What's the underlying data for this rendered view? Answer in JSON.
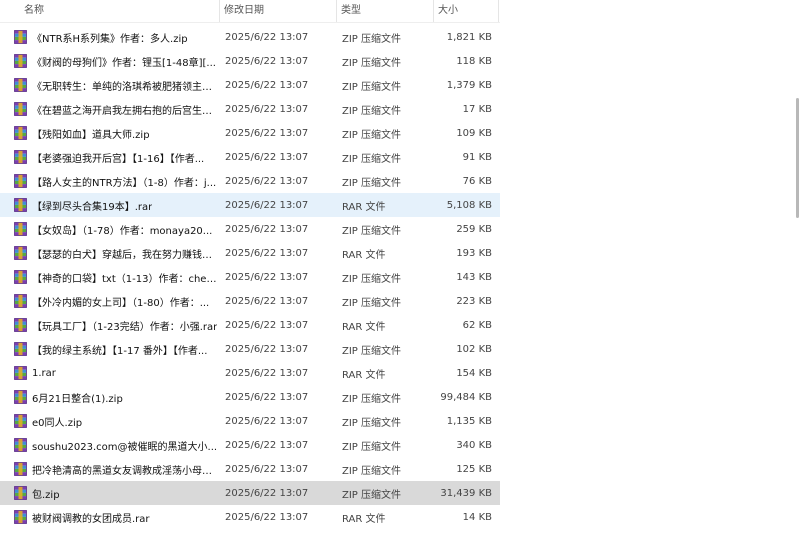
{
  "columns": {
    "name": "名称",
    "date": "修改日期",
    "type": "类型",
    "size": "大小"
  },
  "sort_indicator": "^",
  "files": [
    {
      "name": "《NTR系H系列集》作者：多人.zip",
      "date": "2025/6/22 13:07",
      "type": "ZIP 压缩文件",
      "size": "1,821 KB",
      "state": "normal"
    },
    {
      "name": "《财阀的母狗们》作者：锂玉[1-48章][...",
      "date": "2025/6/22 13:07",
      "type": "ZIP 压缩文件",
      "size": "118 KB",
      "state": "normal"
    },
    {
      "name": "《无职转生：单纯的洛琪希被肥猪领主邀...",
      "date": "2025/6/22 13:07",
      "type": "ZIP 压缩文件",
      "size": "1,379 KB",
      "state": "normal"
    },
    {
      "name": "《在碧蓝之海开启我左拥右抱的后宫生活...",
      "date": "2025/6/22 13:07",
      "type": "ZIP 压缩文件",
      "size": "17 KB",
      "state": "normal"
    },
    {
      "name": "【残阳如血】道具大师.zip",
      "date": "2025/6/22 13:07",
      "type": "ZIP 压缩文件",
      "size": "109 KB",
      "state": "normal"
    },
    {
      "name": "【老婆强迫我开后宫】【1-16】【作者...",
      "date": "2025/6/22 13:07",
      "type": "ZIP 压缩文件",
      "size": "91 KB",
      "state": "normal"
    },
    {
      "name": "【路人女主的NTR方法】（1-8）作者：j...",
      "date": "2025/6/22 13:07",
      "type": "ZIP 压缩文件",
      "size": "76 KB",
      "state": "normal"
    },
    {
      "name": "【绿到尽头合集19本】.rar",
      "date": "2025/6/22 13:07",
      "type": "RAR 文件",
      "size": "5,108 KB",
      "state": "hover"
    },
    {
      "name": "【女奴岛】（1-78）作者：monaya20...",
      "date": "2025/6/22 13:07",
      "type": "ZIP 压缩文件",
      "size": "259 KB",
      "state": "normal"
    },
    {
      "name": "【瑟瑟的白犬】穿越后，我在努力赚钱饲...",
      "date": "2025/6/22 13:07",
      "type": "RAR 文件",
      "size": "193 KB",
      "state": "normal"
    },
    {
      "name": "【神奇的口袋】txt（1-13）作者：chen...",
      "date": "2025/6/22 13:07",
      "type": "ZIP 压缩文件",
      "size": "143 KB",
      "state": "normal"
    },
    {
      "name": "【外冷内媚的女上司】（1-80）作者：...",
      "date": "2025/6/22 13:07",
      "type": "ZIP 压缩文件",
      "size": "223 KB",
      "state": "normal"
    },
    {
      "name": "【玩具工厂】（1-23完结）作者：小强.rar",
      "date": "2025/6/22 13:07",
      "type": "RAR 文件",
      "size": "62 KB",
      "state": "normal"
    },
    {
      "name": "【我的绿主系统】【1-17 番外】【作者...",
      "date": "2025/6/22 13:07",
      "type": "ZIP 压缩文件",
      "size": "102 KB",
      "state": "normal"
    },
    {
      "name": "1.rar",
      "date": "2025/6/22 13:07",
      "type": "RAR 文件",
      "size": "154 KB",
      "state": "normal"
    },
    {
      "name": "6月21日整合(1).zip",
      "date": "2025/6/22 13:07",
      "type": "ZIP 压缩文件",
      "size": "99,484 KB",
      "state": "normal"
    },
    {
      "name": "e0同人.zip",
      "date": "2025/6/22 13:07",
      "type": "ZIP 压缩文件",
      "size": "1,135 KB",
      "state": "normal"
    },
    {
      "name": "soushu2023.com@被催眠的黑道大小...",
      "date": "2025/6/22 13:07",
      "type": "ZIP 压缩文件",
      "size": "340 KB",
      "state": "normal"
    },
    {
      "name": "把冷艳清高的黑道女友调教成淫荡小母狗...",
      "date": "2025/6/22 13:07",
      "type": "ZIP 压缩文件",
      "size": "125 KB",
      "state": "normal"
    },
    {
      "name": "包.zip",
      "date": "2025/6/22 13:07",
      "type": "ZIP 压缩文件",
      "size": "31,439 KB",
      "state": "selected"
    },
    {
      "name": "被财阀调教的女团成员.rar",
      "date": "2025/6/22 13:07",
      "type": "RAR 文件",
      "size": "14 KB",
      "state": "normal"
    }
  ],
  "icon": "archive-icon",
  "colors": {
    "hover": "#e5f1fb",
    "selected": "#d9d9d9",
    "icon_primary": "#7a3fb0",
    "icon_secondary": "#3e8fd6",
    "icon_accent": "#e8b020"
  }
}
